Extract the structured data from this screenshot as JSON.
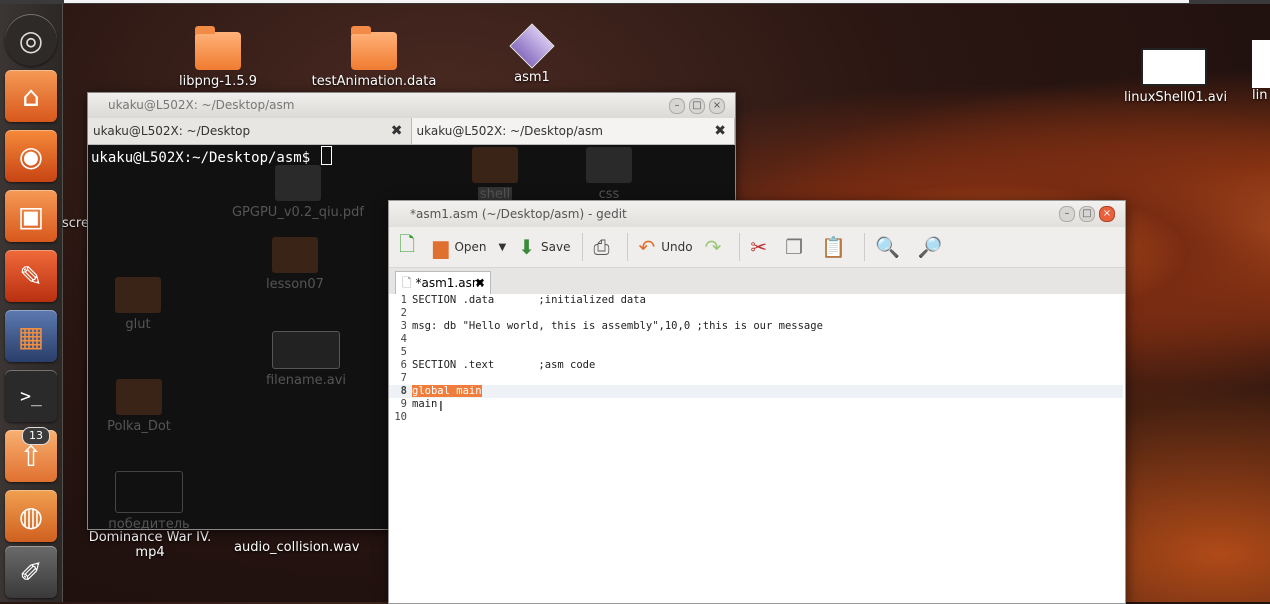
{
  "desktop": {
    "icons": [
      {
        "label": "libpng-1.5.9",
        "type": "folder"
      },
      {
        "label": "testAnimation.data",
        "type": "folder"
      },
      {
        "label": "asm1",
        "type": "file"
      },
      {
        "label": "linuxShell01.avi",
        "type": "video"
      },
      {
        "label": "lin",
        "type": "file"
      },
      {
        "label": "Dominance War IV.",
        "type": "video"
      },
      {
        "label": "mp4",
        "type": "video"
      },
      {
        "label": "audio_collision.wav",
        "type": "audio"
      },
      {
        "label": "screenCapture",
        "type": "file"
      }
    ]
  },
  "launcher": {
    "items": [
      "ubuntu-icon",
      "home-folder-icon",
      "firefox-icon",
      "software-center-icon",
      "system-settings-icon",
      "workspace-icon",
      "terminal-icon",
      "update-manager-icon",
      "chrome-icon",
      "text-editor-icon"
    ],
    "update_badge": "13"
  },
  "terminal": {
    "title": "ukaku@L502X: ~/Desktop/asm",
    "tabs": [
      {
        "label": "ukaku@L502X: ~/Desktop"
      },
      {
        "label": "ukaku@L502X: ~/Desktop/asm"
      }
    ],
    "prompt": "ukaku@L502X:~/Desktop/asm$",
    "background_items": [
      "shell",
      "css",
      "GPGPU_v0.2_qiu.pdf",
      "lesson07",
      "glut",
      "filename.avi",
      "Polka_Dot",
      "победитель"
    ]
  },
  "gedit": {
    "title": "*asm1.asm (~/Desktop/asm) - gedit",
    "toolbar": {
      "open": "Open",
      "save": "Save",
      "undo": "Undo"
    },
    "tab_label": "*asm1.asm",
    "lines": [
      "SECTION .data       ;initialized data",
      "",
      "msg: db \"Hello world, this is assembly\",10,0 ;this is our message",
      "",
      "",
      "SECTION .text       ;asm code",
      "",
      "global main",
      "main",
      ""
    ],
    "line_numbers": [
      "1",
      "2",
      "3",
      "4",
      "5",
      "6",
      "7",
      "8",
      "9",
      "10"
    ],
    "selected_text": "global main",
    "accent": "#f07d3c"
  }
}
